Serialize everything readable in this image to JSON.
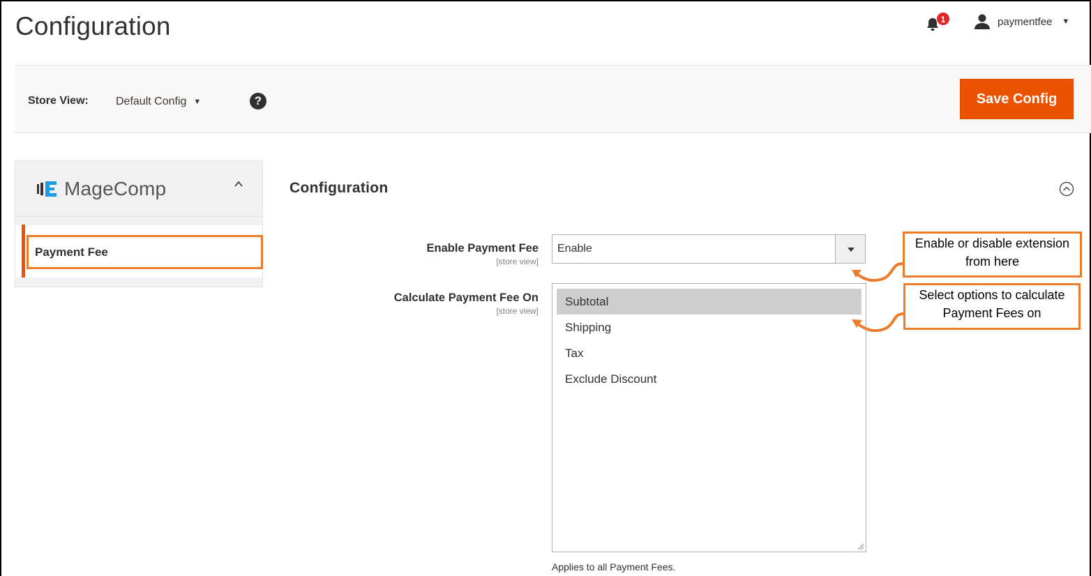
{
  "header": {
    "page_title": "Configuration",
    "notification_count": "1",
    "username": "paymentfee"
  },
  "store_bar": {
    "label": "Store View:",
    "selected": "Default Config",
    "help": "?",
    "save_label": "Save Config"
  },
  "sidebar": {
    "brand": "MageComp",
    "items": [
      {
        "label": "Payment Fee"
      }
    ]
  },
  "section": {
    "title": "Configuration",
    "fields": [
      {
        "label": "Enable Payment Fee",
        "scope": "[store view]",
        "value": "Enable"
      },
      {
        "label": "Calculate Payment Fee On",
        "scope": "[store view]",
        "options": [
          "Subtotal",
          "Shipping",
          "Tax",
          "Exclude Discount"
        ],
        "selected": "Subtotal",
        "note": "Applies to all Payment Fees."
      }
    ]
  },
  "callouts": [
    {
      "line1": "Enable or disable extension",
      "line2": "from here"
    },
    {
      "line1": "Select options to calculate",
      "line2": "Payment Fees on"
    }
  ],
  "colors": {
    "accent": "#eb5202",
    "callout_border": "#eb7d2a",
    "selected_option": "#cecece"
  }
}
